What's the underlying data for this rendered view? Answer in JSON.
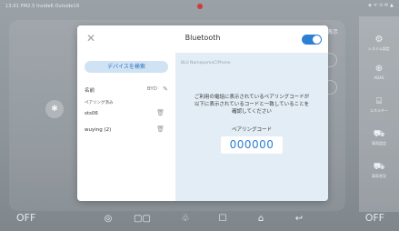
{
  "status_bar": {
    "left_text": "13:01  PM2.5 Inside6  Outside19",
    "right_text": "◈ ᯤ ⊙ ✉ ▲"
  },
  "background": {
    "title_fragment": "≠",
    "right_fragment": "表示",
    "left_circle_icon": "bluetooth-icon"
  },
  "right_panel": {
    "items": [
      {
        "icon": "⚙",
        "label": "システム設定"
      },
      {
        "icon": "⊕",
        "label": "ADAS"
      },
      {
        "icon": "⌸",
        "label": "エネルギー"
      },
      {
        "icon": "⛟",
        "label": "車両設定"
      },
      {
        "icon": "⛟",
        "label": "車両状況"
      }
    ]
  },
  "bottom_bar": {
    "left_off": "OFF",
    "right_off": "OFF",
    "icons": [
      "◎",
      "▢▢",
      "♧",
      "☐",
      "⌂",
      "↩"
    ]
  },
  "modal": {
    "title": "Bluetooth",
    "close_glyph": "✕",
    "toggle_on": true,
    "search_button": "デバイスを検索",
    "name_label": "名前",
    "name_value": "BYD",
    "edit_glyph": "✎",
    "paired_label": "ペアリング済み",
    "devices": [
      "sts06",
      "wuying (2)"
    ],
    "trash_glyph": "🗑",
    "device_id": "BLU NamepamaCIPhone",
    "pair_message_line1": "ご利用の電話に表示されているペアリングコードが",
    "pair_message_line2": "以下に表示されているコードと一致していることを",
    "pair_message_line3": "確認してください",
    "pair_code_label": "ペアリングコード",
    "pair_code": "000000"
  },
  "colors": {
    "accent": "#2d7fd3",
    "right_pane_bg": "#e3edf5",
    "search_button_bg": "#cfe3f5"
  }
}
